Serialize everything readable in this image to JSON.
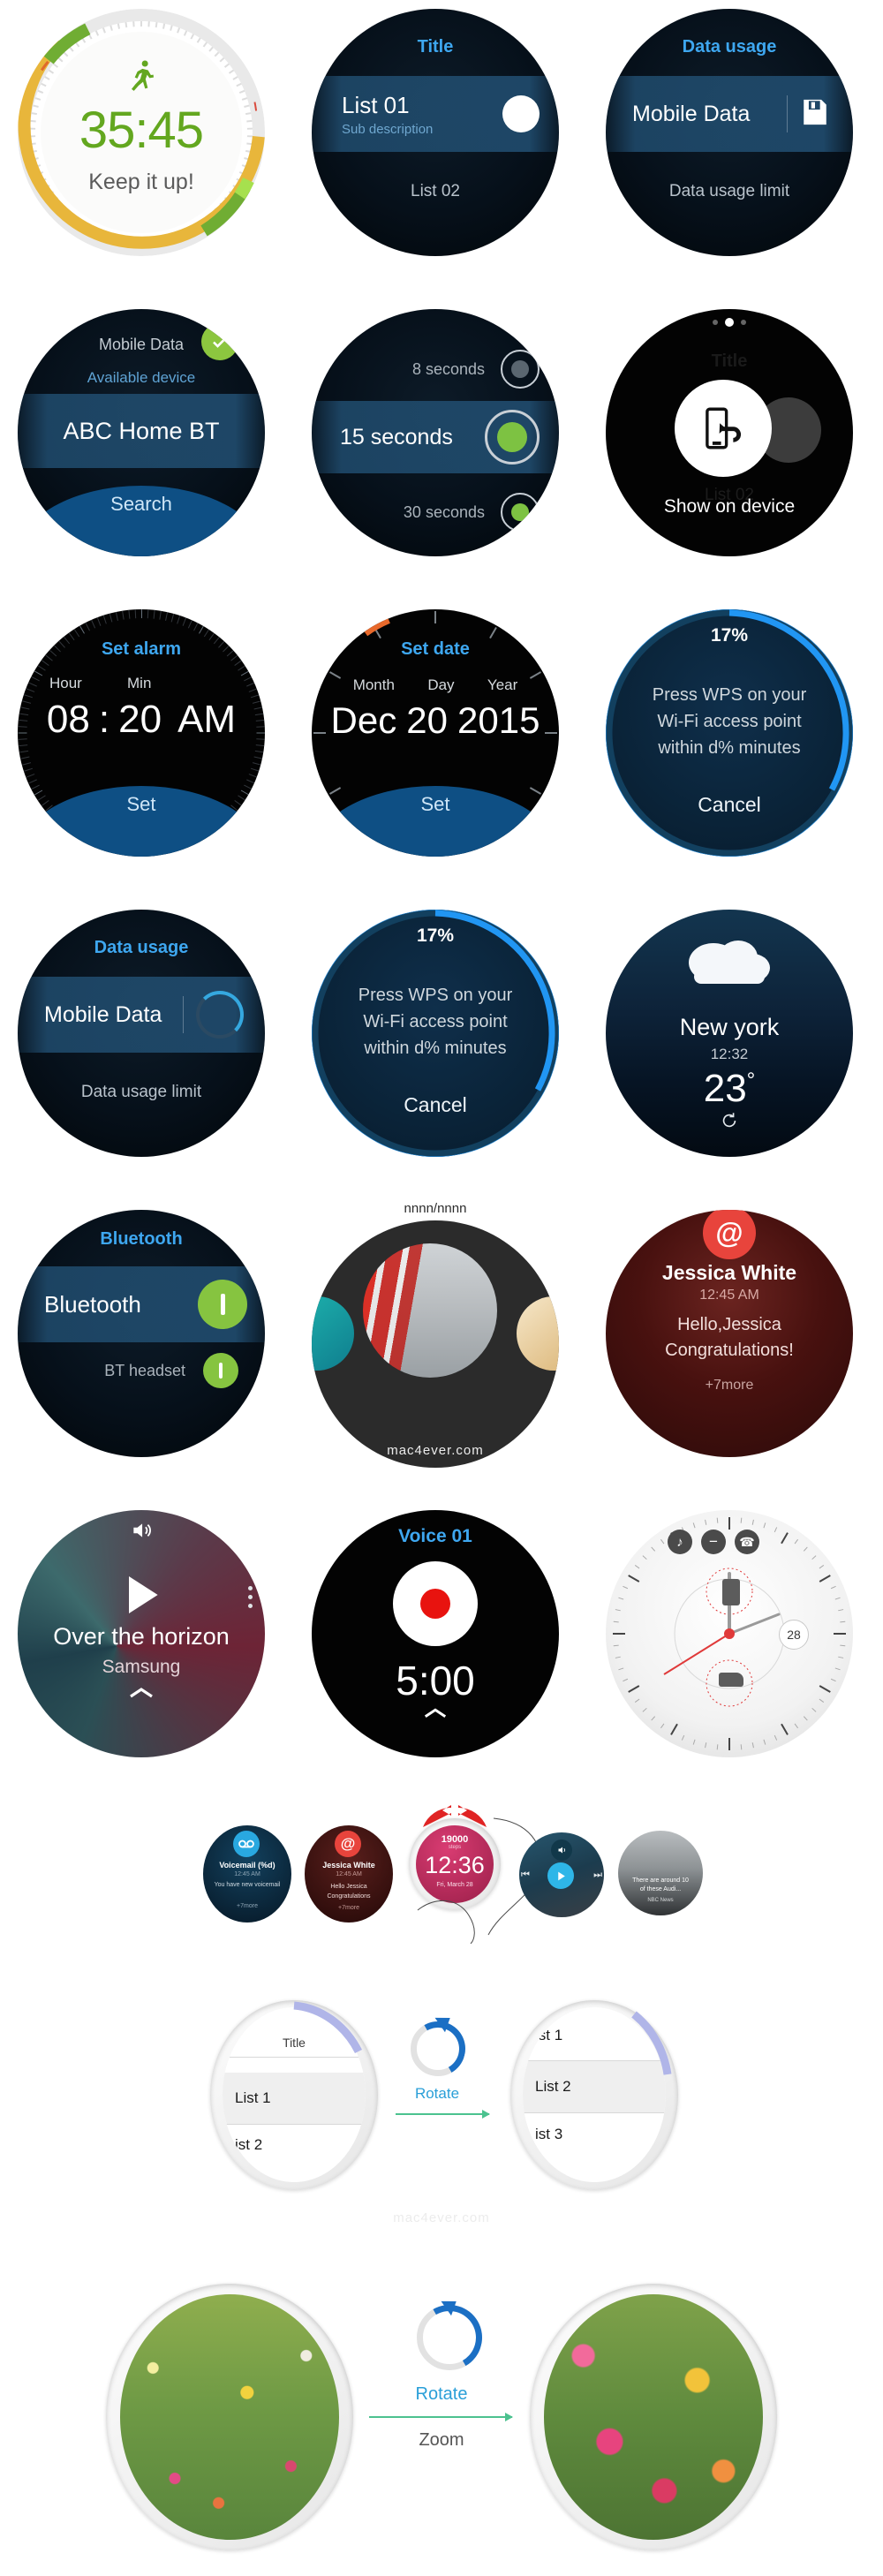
{
  "page": {
    "watermarks": [
      "mac4ever.com",
      "mac4ever.com",
      "mac4ever.com"
    ]
  },
  "screens": [
    {
      "id": "workout-timer",
      "name": "Workout timer",
      "icon": "running-man-icon",
      "time": "35:45",
      "message": "Keep it up!"
    },
    {
      "id": "list-title",
      "name": "Generic list",
      "title": "Title",
      "item_primary": "List 01",
      "item_sub": "Sub description",
      "item_secondary": "List 02",
      "accent": "#3ea7f0"
    },
    {
      "id": "data-usage-save",
      "name": "Data usage",
      "title": "Data usage",
      "item_primary": "Mobile Data",
      "icon": "floppy-save-icon",
      "item_secondary": "Data usage limit"
    },
    {
      "id": "bluetooth-search",
      "name": "Bluetooth available device",
      "header": "Mobile Data",
      "check_icon": "check-circle-icon",
      "divider_label": "Available device",
      "item_primary": "ABC Home BT",
      "button": "Search"
    },
    {
      "id": "screen-timeout",
      "name": "Screen timeout radio list",
      "options": [
        {
          "label": "8 seconds",
          "selected": false,
          "dot": "#5a6670"
        },
        {
          "label": "15 seconds",
          "selected": true,
          "dot": "#7dc242"
        },
        {
          "label": "30 seconds",
          "selected": false,
          "dot": "#7dc242"
        }
      ]
    },
    {
      "id": "show-on-device",
      "name": "Show on device overlay",
      "ghost_title": "Title",
      "ghost_item": "List 02",
      "icon": "phone-share-icon",
      "caption": "Show on device",
      "dots": 3
    },
    {
      "id": "set-alarm",
      "name": "Set alarm",
      "title": "Set alarm",
      "fields": [
        {
          "label": "Hour",
          "value": "08"
        },
        {
          "label": "Min",
          "value": "20"
        }
      ],
      "meridiem": "AM",
      "separator": ":",
      "button": "Set"
    },
    {
      "id": "set-date",
      "name": "Set date",
      "title": "Set date",
      "fields": [
        {
          "label": "Month",
          "value": "Dec"
        },
        {
          "label": "Day",
          "value": "20"
        },
        {
          "label": "Year",
          "value": "2015"
        }
      ],
      "button": "Set"
    },
    {
      "id": "wps-progress-a",
      "name": "WPS progress (ring)",
      "percent": "17%",
      "percent_value": 17,
      "message_lines": [
        "Press WPS on your",
        "Wi-Fi access point",
        "within d% minutes"
      ],
      "button": "Cancel",
      "ring_color": "#2196f3"
    },
    {
      "id": "data-usage-loading",
      "name": "Data usage loading",
      "title": "Data usage",
      "item_primary": "Mobile Data",
      "icon": "spinner-icon",
      "item_secondary": "Data usage limit"
    },
    {
      "id": "wps-progress-b",
      "name": "WPS progress (ring) 2",
      "percent": "17%",
      "percent_value": 17,
      "message_lines": [
        "Press WPS on your",
        "Wi-Fi access point",
        "within d% minutes"
      ],
      "button": "Cancel",
      "ring_color": "#2196f3"
    },
    {
      "id": "weather",
      "name": "Weather",
      "icon": "cloud-icon",
      "city": "New york",
      "time": "12:32",
      "temperature": "23",
      "degree": "°",
      "refresh_icon": "refresh-icon"
    },
    {
      "id": "bluetooth-toggles",
      "name": "Bluetooth settings",
      "title": "Bluetooth",
      "item_primary": "Bluetooth",
      "item_primary_toggle": "on",
      "item_secondary": "BT headset",
      "item_secondary_toggle": "on",
      "toggle_color": "#86c440"
    },
    {
      "id": "gallery",
      "name": "Gallery carousel",
      "counter": "nnnn/nnnn",
      "photo": "big-ben-red-bus-photo"
    },
    {
      "id": "notification",
      "name": "Email notification",
      "icon": "at-sign-icon",
      "sender": "Jessica White",
      "time": "12:45 AM",
      "body_lines": [
        "Hello,Jessica",
        "Congratulations!"
      ],
      "more": "+7more",
      "badge_color": "#e8443c"
    },
    {
      "id": "music-player",
      "name": "Music player",
      "volume_icon": "volume-icon",
      "play_icon": "play-icon",
      "more_icon": "more-vertical-icon",
      "track": "Over the horizon",
      "artist": "Samsung",
      "chevron_icon": "chevron-up-icon"
    },
    {
      "id": "voice-recorder",
      "name": "Voice recorder",
      "title": "Voice 01",
      "record_icon": "record-button-icon",
      "duration": "5:00",
      "chevron_icon": "chevron-up-icon"
    },
    {
      "id": "analog-watchface",
      "name": "Analog watch face",
      "date": "28",
      "complication_icons": [
        "music-note-icon",
        "do-not-disturb-icon",
        "missed-call-icon"
      ],
      "sub_icons": [
        "battery-icon",
        "shoe-icon"
      ]
    }
  ],
  "carousel": {
    "name": "Notification carousel",
    "cards": [
      {
        "id": "voicemail-card",
        "icon": "voicemail-icon",
        "title": "Voicemail (%d)",
        "time": "12:45 AM",
        "body": "You have new voicemail",
        "more": "+7more"
      },
      {
        "id": "email-card",
        "icon": "at-sign-icon",
        "title": "Jessica White",
        "time": "12:45 AM",
        "body_lines": [
          "Hello Jessica",
          "Congratulations"
        ],
        "more": "+7more"
      },
      {
        "id": "watchface-card",
        "steps": "19000",
        "steps_unit": "steps",
        "time": "12:36",
        "date": "Fri, March 28"
      },
      {
        "id": "music-card",
        "volume_icon": "volume-icon",
        "prev_icon": "previous-icon",
        "play_icon": "play-icon",
        "next_icon": "next-icon"
      },
      {
        "id": "news-card",
        "headline_lines": [
          "There are around 10",
          "of these Audi..."
        ],
        "source": "NBC News"
      }
    ]
  },
  "demos": [
    {
      "id": "list-rotate-demo",
      "name": "List rotate demo",
      "action_label": "Rotate",
      "sub_label": "",
      "before": {
        "title": "Title",
        "items": [
          "List 1",
          "ist 2"
        ],
        "selected": "List 1"
      },
      "after": {
        "items": [
          "ist 1",
          "List 2",
          "ist 3"
        ],
        "selected": "List 2"
      }
    },
    {
      "id": "gallery-zoom-demo",
      "name": "Gallery zoom demo",
      "action_label": "Rotate",
      "sub_label": "Zoom",
      "before": {
        "photo": "flower-field-wide"
      },
      "after": {
        "photo": "flower-field-zoomed"
      }
    }
  ]
}
